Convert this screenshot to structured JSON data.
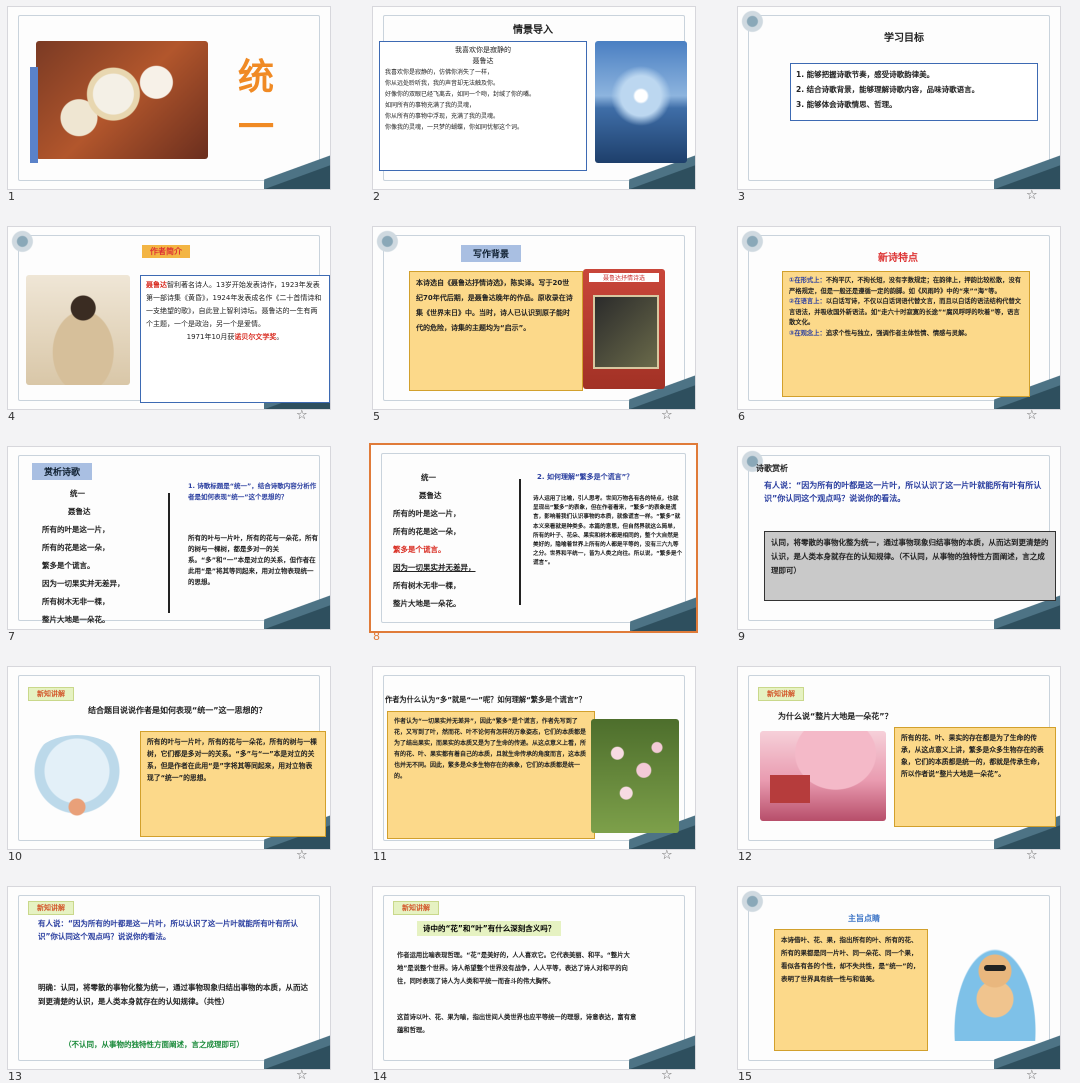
{
  "slides": [
    {
      "num": "1",
      "title": "统一",
      "title_color": "#f08a24"
    },
    {
      "num": "2",
      "title": "情景导入",
      "poem_title": "我喜欢你是寂静的",
      "poem_author": "聂鲁达",
      "poem_lines": [
        "我喜欢你是寂静的，仿佛你消失了一样，",
        "你从远处聆听我，我的声音却无法触及你。",
        "好像你的双眼已经飞离去，如同一个吻，封缄了你的嘴。",
        "如同所有的事物充满了我的灵魂，",
        "你从所有的事物中浮现，充满了我的灵魂。",
        "你像我的灵魂，一只梦的蝴蝶，你如同忧郁这个词。"
      ]
    },
    {
      "num": "3",
      "title": "学习目标",
      "goals": [
        "1. 能够把握诗歌节奏，感受诗歌韵律美。",
        "2. 结合诗歌背景，能够理解诗歌内容，品味诗歌语言。",
        "3. 能够体会诗歌情思、哲理。"
      ]
    },
    {
      "num": "4",
      "title": "作者简介",
      "name": "聂鲁达",
      "bio": "智利著名诗人。13岁开始发表诗作，1923年发表第一部诗集《黄昏》，1924年发表成名作《二十首情诗和一支绝望的歌》，自此登上智利诗坛。聂鲁达的一生有两个主题，一个是政治，另一个是爱情。",
      "award_prefix": "1971年10月获",
      "award": "诺贝尔文学奖",
      "award_suffix": "。"
    },
    {
      "num": "5",
      "title": "写作背景",
      "text": "本诗选自《聂鲁达抒情诗选》，陈实译。写于20世纪70年代后期，是聂鲁达晚年的作品。原收录在诗集《世界末日》中。当时，诗人已认识到原子能时代的危险，诗集的主题均为“启示”。",
      "book_title": "聂鲁达抒情诗选"
    },
    {
      "num": "6",
      "title": "新诗特点",
      "items": [
        {
          "label": "①在形式上：",
          "text": "不拘平仄，不拘长短，没有字数规定；在韵律上，押韵比较松散，没有严格规定，但是一般还是遵循一定的韵脚。如《风雨吟》中的“来”“海”等。"
        },
        {
          "label": "②在语言上：",
          "text": "以白话写诗，不仅以白话词语代替文言，而且以白话的语法结构代替文言语法，并吸收国外新语法。如“走六十时寂寞的长途”“腐风呼呼的吹着”等，语言散文化。"
        },
        {
          "label": "③在观念上：",
          "text": "追求个性与独立，强调作者主体性情、情感与灵解。"
        }
      ]
    },
    {
      "num": "7",
      "title": "赏析诗歌",
      "poem_title": "统一",
      "poem_author": "聂鲁达",
      "lines": [
        "所有的叶是这一片，",
        "所有的花是这一朵，",
        "繁多是个谎言。",
        "因为一切果实并无差异，",
        "所有树木无非一棵，",
        "整片大地是一朵花。"
      ],
      "question": "1. 诗歌标题是“统一”，结合诗歌内容分析作者是如何表现“统一”这个思想的？",
      "answer": "所有的叶与一片叶，所有的花与一朵花，所有的树与一棵树，都是多对一的关系。“多”和“一”本是对立的关系，但作者在此用“是”将其等同起来，用对立物表现统一的思想。"
    },
    {
      "num": "8",
      "title": "2. 如何理解“繁多是个谎言”？",
      "poem_title": "统一",
      "poem_author": "聂鲁达",
      "lines": [
        "所有的叶是这一片，",
        "所有的花是这一朵，",
        "繁多是个谎言。",
        "因为一切果实并无差异，",
        "所有树木无非一棵，",
        "整片大地是一朵花。"
      ],
      "answer": "诗人运用了比喻，引人思考。世间万物各有各的特点，也就呈现出“繁多”的表象，但在作者看来，“繁多”的表象是谎言，影响着我们认识事物的本质，就像谎言一样。“繁多”就本义来看就是种类多。本篇的意思，但自然界就这么简单，所有的叶子、花朵、果实和树木都是相同的，整个大自然是美好的，隐喻着世界上所有的人都是平等的，没有三六九等之分。世界和平统一，皆为人类之向往。所以说，“繁多是个谎言”。"
    },
    {
      "num": "9",
      "title": "诗歌赏析",
      "question": "有人说：“因为所有的叶都是这一片叶，所以认识了这一片叶就能所有叶有所认识”你认同这个观点吗？说说你的看法。",
      "answer": "认同，将零散的事物化整为统一，通过事物现象归结事物的本质，从而达到更清楚的认识，是人类本身就存在的认知规律。（不认同，从事物的独特性方面阐述，言之成理即可）"
    },
    {
      "num": "10",
      "tag": "新知讲解",
      "title": "结合题目说说作者是如何表现“统一”这一思想的？",
      "answer": "所有的叶与一片叶，所有的花与一朵花，所有的树与一棵树，它们都是多对一的关系。“多”与“一”本是对立的关系，但是作者在此用“是”字将其等同起来，用对立物表现了“统一”的思想。"
    },
    {
      "num": "11",
      "title": "作者为什么认为“多”就是“一”呢？如何理解“繁多是个谎言”？",
      "answer": "作者认为“一切果实并无差异”，因此“繁多”是个谎言，作者先写到了花，又写到了叶，然而花、叶不论何有怎样的万象姿态，它们的本质都是为了结出果实，而果实的本质又是为了生命的传递。从这点意义上看，所有的花、叶、果实都有着自己的本质，且就生命传承的角度而言，这本质也并无不同。因此，繁多是众多生物存在的表象，它们的本质都是统一的。"
    },
    {
      "num": "12",
      "tag": "新知讲解",
      "title": "为什么说“整片大地是一朵花”？",
      "answer": "所有的花、叶、果实的存在都是为了生命的传承，从这点意义上讲，繁多是众多生物存在的表象，它们的本质都是统一的，都就是传承生命，所以作者说“整片大地是一朵花”。"
    },
    {
      "num": "13",
      "tag": "新知讲解",
      "question": "有人说：“因为所有的叶都是这一片叶，所以认识了这一片叶就能所有叶有所认识”你认同这个观点吗？说说你的看法。",
      "answer": "明确：认同，将零散的事物化整为统一，通过事物现象归结出事物的本质，从而达到更清楚的认识，是人类本身就存在的认知规律。（共性）",
      "alt": "（不认同，从事物的独特性方面阐述，言之成理即可）"
    },
    {
      "num": "14",
      "tag": "新知讲解",
      "title": "诗中的“花”和“叶”有什么深刻含义吗？",
      "answer": "作者运用比喻表现哲理。“花”是美好的，人人喜欢它。它代表美丽、和平。“整片大地”是说整个世界。诗人希望整个世界没有战争，人人平等，表达了诗人对和平的向往，同时表现了诗人为人类和平统一而奋斗的伟大胸怀。",
      "answer2": "这首诗以叶、花、果为喻，指出世间人类世界也应平等统一的理想，诗意表达，富有意蕴和哲理。"
    },
    {
      "num": "15",
      "title": "主旨点睛",
      "text": "本诗借叶、花、果，指出所有的叶、所有的花、所有的果都是同一片叶、同一朵花、同一个果，看似各有各的个性，却不失共性，是“统一”的，表明了世界具有统一性与和谐美。"
    }
  ]
}
